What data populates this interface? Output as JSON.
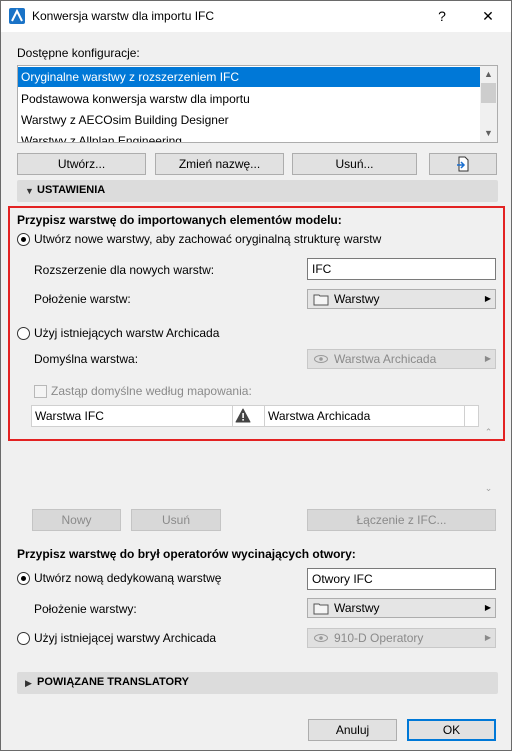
{
  "window": {
    "title": "Konwersja warstw dla importu IFC",
    "help_label": "?",
    "close_label": "✕"
  },
  "configs": {
    "label": "Dostępne konfiguracje:",
    "items": [
      {
        "label": "Oryginalne warstwy z rozszerzeniem IFC",
        "selected": true
      },
      {
        "label": "Podstawowa konwersja warstw dla importu",
        "selected": false
      },
      {
        "label": "Warstwy z AECOsim Building Designer",
        "selected": false
      },
      {
        "label": "Warstwy z Allplan Engineering",
        "selected": false
      }
    ],
    "buttons": {
      "create": "Utwórz...",
      "rename": "Zmień nazwę...",
      "delete": "Usuń..."
    }
  },
  "settings": {
    "header": "USTAWIENIA",
    "model_heading": "Przypisz warstwę do importowanych elementów modelu:",
    "option_new": "Utwórz nowe warstwy, aby zachować oryginalną strukturę warstw",
    "suffix_label": "Rozszerzenie dla nowych warstw:",
    "suffix_value": "IFC",
    "location_label": "Położenie warstw:",
    "location_value": "Warstwy",
    "option_existing": "Użyj istniejących warstw Archicada",
    "default_layer_label": "Domyślna warstwa:",
    "default_layer_value": "Warstwa Archicada",
    "override_label": "Zastąp domyślne według mapowania:",
    "table": {
      "col_ifc": "Warstwa IFC",
      "col_archicada": "Warstwa Archicada"
    },
    "table_buttons": {
      "new": "Nowy",
      "delete": "Usuń",
      "connect": "Łączenie z IFC..."
    },
    "opening_heading": "Przypisz warstwę do brył operatorów wycinających otwory:",
    "opening_option_new": "Utwórz nową dedykowaną warstwę",
    "opening_new_value": "Otwory IFC",
    "opening_location_label": "Położenie warstwy:",
    "opening_location_value": "Warstwy",
    "opening_option_existing": "Użyj istniejącej warstwy Archicada",
    "opening_existing_value": "910-D Operatory"
  },
  "translators": {
    "header": "POWIĄZANE TRANSLATORY"
  },
  "footer": {
    "cancel": "Anuluj",
    "ok": "OK"
  },
  "colors": {
    "accent": "#0078d7",
    "highlight_border": "#e32222"
  }
}
